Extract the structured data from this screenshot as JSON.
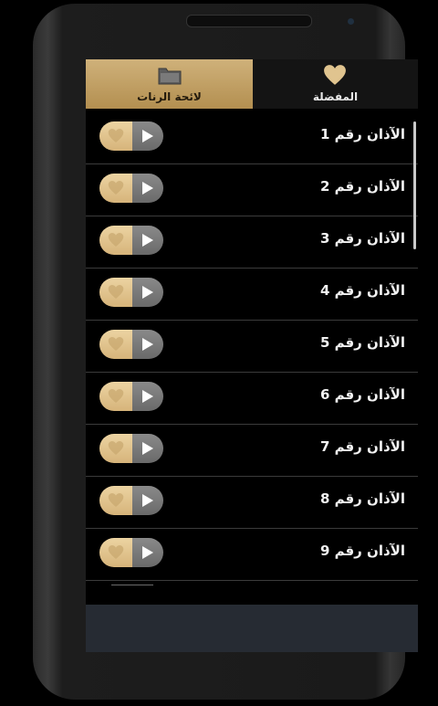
{
  "tabs": [
    {
      "label": "لائحة الرنات",
      "icon": "folder-icon",
      "active": true
    },
    {
      "label": "المفضلة",
      "icon": "heart-icon",
      "active": false
    }
  ],
  "items": [
    {
      "label": "الآذان رقم 1"
    },
    {
      "label": "الآذان رقم 2"
    },
    {
      "label": "الآذان رقم 3"
    },
    {
      "label": "الآذان رقم 4"
    },
    {
      "label": "الآذان رقم 5"
    },
    {
      "label": "الآذان رقم 6"
    },
    {
      "label": "الآذان رقم 7"
    },
    {
      "label": "الآذان رقم 8"
    },
    {
      "label": "الآذان رقم 9"
    }
  ],
  "colors": {
    "accent_gold": "#cfb17a",
    "screen_bg": "#000000",
    "bottom_bar": "#262b33"
  }
}
